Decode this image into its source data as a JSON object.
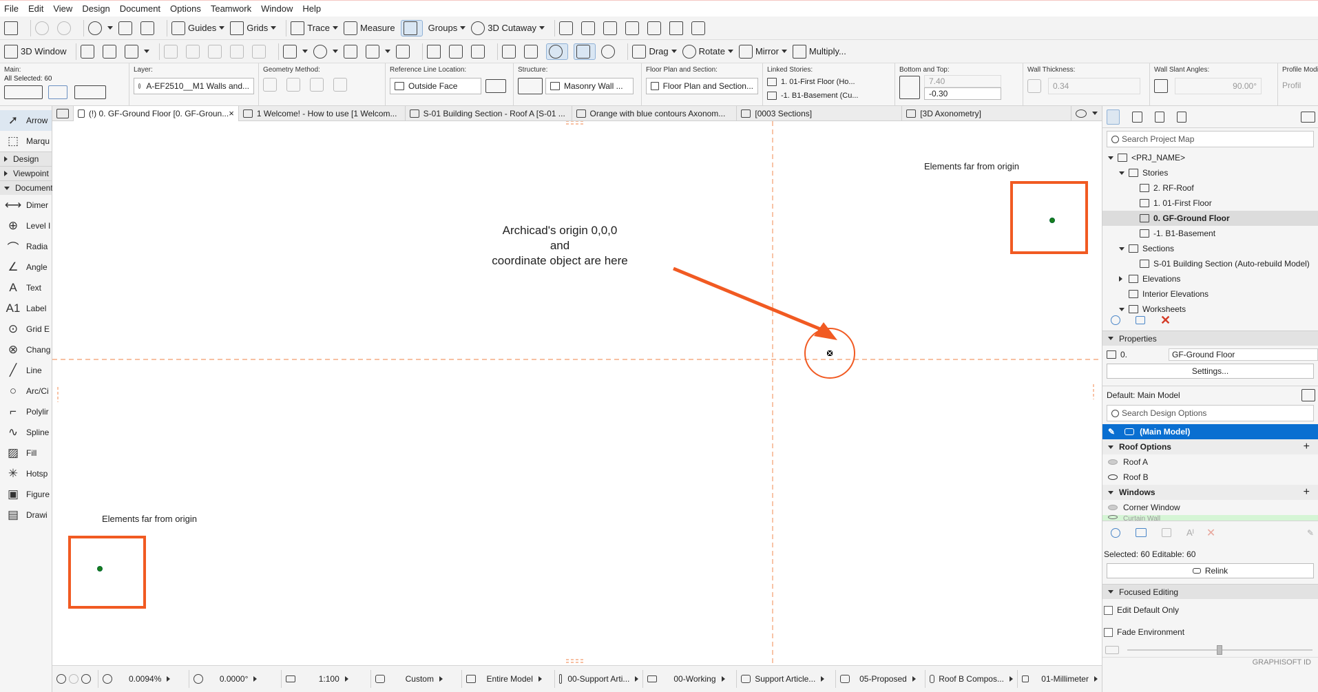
{
  "menu": [
    "File",
    "Edit",
    "View",
    "Design",
    "Document",
    "Options",
    "Teamwork",
    "Window",
    "Help"
  ],
  "toolbar1": {
    "guides": "Guides",
    "grids": "Grids",
    "trace": "Trace",
    "measure": "Measure",
    "groups": "Groups",
    "cutaway": "3D Cutaway"
  },
  "toolbar2": {
    "window3d": "3D Window",
    "drag": "Drag",
    "rotate": "Rotate",
    "mirror": "Mirror",
    "multiply": "Multiply..."
  },
  "infobox": {
    "main_label": "Main:",
    "all_selected": "All Selected: 60",
    "layer_label": "Layer:",
    "layer_value": "A-EF2510__M1 Walls and...",
    "geometry_label": "Geometry Method:",
    "refline_label": "Reference Line Location:",
    "refline_value": "Outside Face",
    "structure_label": "Structure:",
    "structure_value": "Masonry Wall ...",
    "floorplan_label": "Floor Plan and Section:",
    "floorplan_value": "Floor Plan and Section...",
    "linked_label": "Linked Stories:",
    "linked_top": "1. 01-First Floor (Ho...",
    "linked_bottom": "-1. B1-Basement (Cu...",
    "bottomtop_label": "Bottom and Top:",
    "top_value": "7.40",
    "bottom_value": "-0.30",
    "thickness_label": "Wall Thickness:",
    "thickness_value": "0.34",
    "slant_label": "Wall Slant Angles:",
    "slant_value": "90.00°",
    "profile_label": "Profile Modifie",
    "profile_value": "Profil"
  },
  "toolbox": {
    "arrow": "Arrow",
    "marquee": "Marqu",
    "design": "Design",
    "viewpoint": "Viewpoint",
    "document": "Document",
    "items": [
      "Dimer",
      "Level I",
      "Radia",
      "Angle",
      "Text",
      "Label",
      "Grid E",
      "Chang",
      "Line",
      "Arc/Ci",
      "Polylir",
      "Spline",
      "Fill",
      "Hotsp",
      "Figure",
      "Drawi"
    ],
    "glyphs": [
      "⟷",
      "⊕",
      "⌒",
      "∠",
      "A",
      "A1",
      "⊙",
      "⊗",
      "╱",
      "○",
      "⌐",
      "∿",
      "▨",
      "✳",
      "▣",
      "▤"
    ]
  },
  "tabs": [
    "(!) 0. GF-Ground Floor [0. GF-Groun...",
    "1 Welcome! - How to use [1 Welcom...",
    "S-01 Building Section - Roof A [S-01 ...",
    "Orange with blue contours Axonom...",
    "[0003 Sections]",
    "[3D Axonometry]"
  ],
  "canvas": {
    "origin_line1": "Archicad's origin 0,0,0",
    "origin_line2": "and",
    "origin_line3": "coordinate object are here",
    "far_label_top": "Elements far from origin",
    "far_label_bottom": "Elements far from origin",
    "accent": "#f15a22",
    "point": "#1a7f1a"
  },
  "status": {
    "zoom": "0.0094%",
    "angle": "0.0000°",
    "scale": "1:100",
    "custom": "Custom",
    "model": "Entire Model",
    "layer": "00-Support Arti...",
    "pen": "00-Working",
    "graphic": "Support Article...",
    "renovation": "05-Proposed",
    "option": "Roof B Compos...",
    "dimension": "01-Millimeter"
  },
  "navigator": {
    "search_placeholder": "Search Project Map",
    "items": [
      {
        "label": "<PRJ_NAME>",
        "indent": 0,
        "expander": "down"
      },
      {
        "label": "Stories",
        "indent": 1,
        "expander": "down"
      },
      {
        "label": "2. RF-Roof",
        "indent": 2,
        "expander": ""
      },
      {
        "label": "1. 01-First Floor",
        "indent": 2,
        "expander": ""
      },
      {
        "label": "0. GF-Ground Floor",
        "indent": 2,
        "expander": "",
        "selected": true
      },
      {
        "label": "-1. B1-Basement",
        "indent": 2,
        "expander": ""
      },
      {
        "label": "Sections",
        "indent": 1,
        "expander": "down"
      },
      {
        "label": "S-01 Building Section (Auto-rebuild Model)",
        "indent": 2,
        "expander": ""
      },
      {
        "label": "Elevations",
        "indent": 1,
        "expander": "right"
      },
      {
        "label": "Interior Elevations",
        "indent": 1,
        "expander": ""
      },
      {
        "label": "Worksheets",
        "indent": 1,
        "expander": "down"
      }
    ],
    "properties": "Properties",
    "prop_id": "0.",
    "prop_name": "GF-Ground Floor",
    "settings": "Settings..."
  },
  "design_options": {
    "default": "Default: Main Model",
    "search_placeholder": "Search Design Options",
    "main_model": "(Main Model)",
    "roof_options": "Roof Options",
    "roof_a": "Roof A",
    "roof_b": "Roof B",
    "windows": "Windows",
    "corner_window": "Corner Window",
    "curtain_wall": "Curtain Wall",
    "selected": "Selected: 60 Editable: 60",
    "relink": "Relink",
    "focused": "Focused Editing",
    "edit_default": "Edit Default Only",
    "fade_env": "Fade Environment",
    "graphisoft": "GRAPHISOFT ID"
  }
}
